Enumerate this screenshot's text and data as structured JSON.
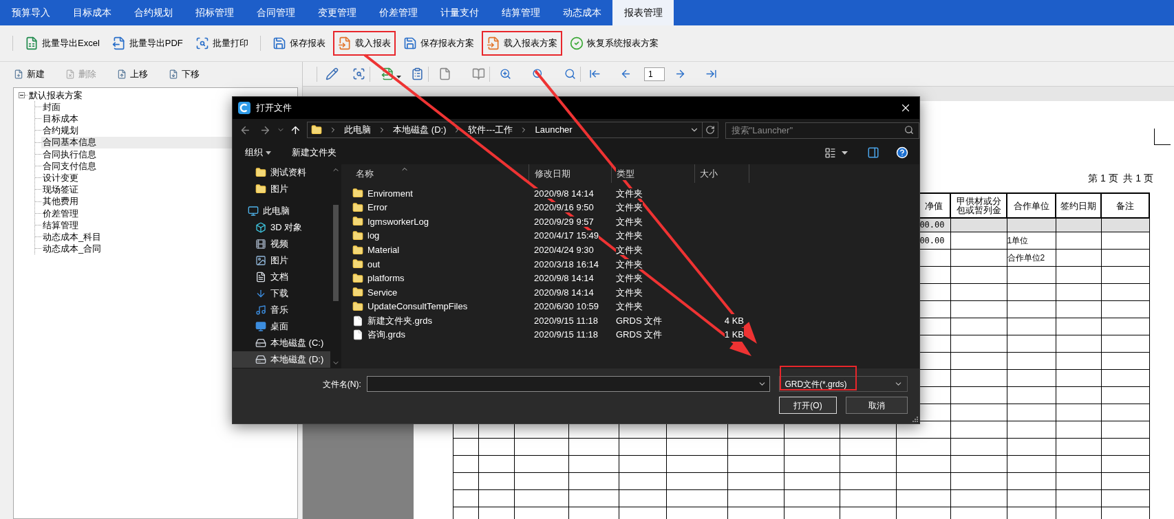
{
  "menu_tabs": [
    {
      "label": "预算导入",
      "selected": false
    },
    {
      "label": "目标成本",
      "selected": false
    },
    {
      "label": "合约规划",
      "selected": false
    },
    {
      "label": "招标管理",
      "selected": false
    },
    {
      "label": "合同管理",
      "selected": false
    },
    {
      "label": "变更管理",
      "selected": false
    },
    {
      "label": "价差管理",
      "selected": false
    },
    {
      "label": "计量支付",
      "selected": false
    },
    {
      "label": "结算管理",
      "selected": false
    },
    {
      "label": "动态成本",
      "selected": false
    },
    {
      "label": "报表管理",
      "selected": true
    }
  ],
  "toolbar": [
    {
      "label": "批量导出Excel",
      "highlighted": false
    },
    {
      "label": "批量导出PDF",
      "highlighted": false
    },
    {
      "label": "批量打印",
      "highlighted": false
    },
    {
      "label": "保存报表",
      "highlighted": false
    },
    {
      "label": "载入报表",
      "highlighted": true
    },
    {
      "label": "保存报表方案",
      "highlighted": false
    },
    {
      "label": "载入报表方案",
      "highlighted": true
    },
    {
      "label": "恢复系统报表方案",
      "highlighted": false
    }
  ],
  "left_toolbar": [
    {
      "label": "新建",
      "disabled": false
    },
    {
      "label": "删除",
      "disabled": true
    },
    {
      "label": "上移",
      "disabled": false
    },
    {
      "label": "下移",
      "disabled": false
    }
  ],
  "tree": {
    "label": "默认报表方案",
    "expanded": true,
    "children": [
      {
        "label": "封面",
        "selected": false
      },
      {
        "label": "目标成本",
        "selected": false
      },
      {
        "label": "合约规划",
        "selected": false
      },
      {
        "label": "合同基本信息",
        "selected": true
      },
      {
        "label": "合同执行信息",
        "selected": false
      },
      {
        "label": "合同支付信息",
        "selected": false
      },
      {
        "label": "设计变更",
        "selected": false
      },
      {
        "label": "现场签证",
        "selected": false
      },
      {
        "label": "其他费用",
        "selected": false
      },
      {
        "label": "价差管理",
        "selected": false
      },
      {
        "label": "结算管理",
        "selected": false
      },
      {
        "label": "动态成本_科目",
        "selected": false
      },
      {
        "label": "动态成本_合同",
        "selected": false
      }
    ]
  },
  "preview_toolbar": {
    "page_number": "1"
  },
  "report": {
    "page_label": "第 1 页  共 1 页",
    "columns": [
      "净值",
      "甲供材或分包或暂列金",
      "合作单位",
      "签约日期",
      "备注"
    ],
    "rows": [
      {
        "shaded": true,
        "net_value": "00.00"
      },
      {
        "shaded": false,
        "net_value": "00.00",
        "partner": "1单位"
      },
      {
        "shaded": false,
        "partner": "合作单位2"
      }
    ]
  },
  "dialog": {
    "title": "打开文件",
    "breadcrumb": [
      "此电脑",
      "本地磁盘 (D:)",
      "软件---工作",
      "Launcher"
    ],
    "search_placeholder": "搜索\"Launcher\"",
    "commands": [
      "组织",
      "新建文件夹"
    ],
    "nav": [
      {
        "label": "测试资料",
        "kind": "folder",
        "selected": false
      },
      {
        "label": "图片",
        "kind": "folder",
        "selected": false
      },
      {
        "label": "此电脑",
        "kind": "computer",
        "selected": false
      },
      {
        "label": "3D 对象",
        "kind": "objects",
        "selected": false
      },
      {
        "label": "视频",
        "kind": "video",
        "selected": false
      },
      {
        "label": "图片",
        "kind": "pictures",
        "selected": false
      },
      {
        "label": "文档",
        "kind": "documents",
        "selected": false
      },
      {
        "label": "下载",
        "kind": "downloads",
        "selected": false
      },
      {
        "label": "音乐",
        "kind": "music",
        "selected": false
      },
      {
        "label": "桌面",
        "kind": "desktop",
        "selected": false
      },
      {
        "label": "本地磁盘 (C:)",
        "kind": "drive",
        "selected": false
      },
      {
        "label": "本地磁盘 (D:)",
        "kind": "drive",
        "selected": true
      }
    ],
    "columns": [
      "名称",
      "修改日期",
      "类型",
      "大小"
    ],
    "files": [
      {
        "name": "Enviroment",
        "modified": "2020/9/8 14:14",
        "type": "文件夹",
        "kind": "folder"
      },
      {
        "name": "Error",
        "modified": "2020/9/16 9:50",
        "type": "文件夹",
        "kind": "folder"
      },
      {
        "name": "IgmsworkerLog",
        "modified": "2020/9/29 9:57",
        "type": "文件夹",
        "kind": "folder"
      },
      {
        "name": "log",
        "modified": "2020/4/17 15:49",
        "type": "文件夹",
        "kind": "folder"
      },
      {
        "name": "Material",
        "modified": "2020/4/24 9:30",
        "type": "文件夹",
        "kind": "folder"
      },
      {
        "name": "out",
        "modified": "2020/3/18 16:14",
        "type": "文件夹",
        "kind": "folder"
      },
      {
        "name": "platforms",
        "modified": "2020/9/8 14:14",
        "type": "文件夹",
        "kind": "folder"
      },
      {
        "name": "Service",
        "modified": "2020/9/8 14:14",
        "type": "文件夹",
        "kind": "folder"
      },
      {
        "name": "UpdateConsultTempFiles",
        "modified": "2020/6/30 10:59",
        "type": "文件夹",
        "kind": "folder"
      },
      {
        "name": "新建文件夹.grds",
        "modified": "2020/9/15 11:18",
        "type": "GRDS 文件",
        "size": "4 KB",
        "kind": "file"
      },
      {
        "name": "咨询.grds",
        "modified": "2020/9/15 11:18",
        "type": "GRDS 文件",
        "size": "1 KB",
        "kind": "file"
      }
    ],
    "filename_label": "文件名(N):",
    "filetype": "GRD文件(*.grds)",
    "filetype_highlighted": true,
    "buttons": [
      "打开(O)",
      "取消"
    ]
  }
}
